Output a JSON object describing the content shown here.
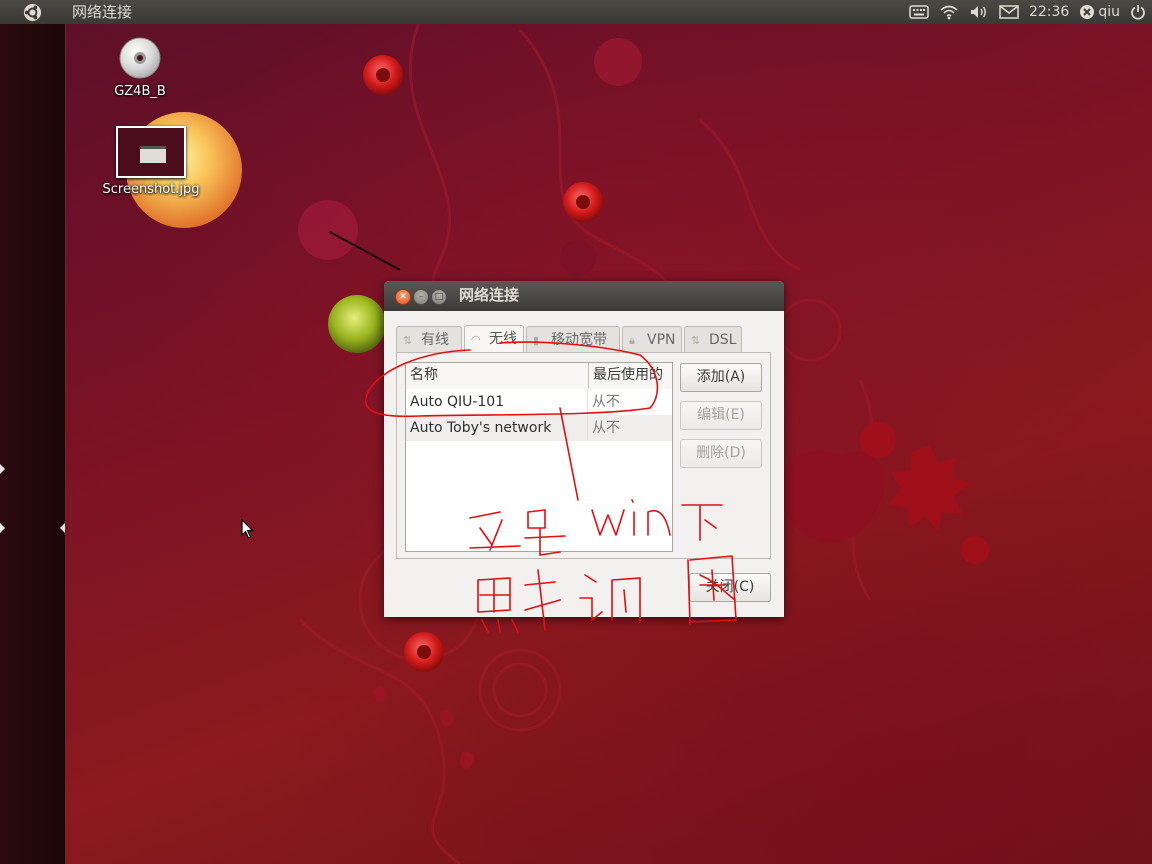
{
  "top_panel": {
    "title": "网络连接",
    "clock": "22:36",
    "user": "qiu",
    "icons": [
      "ubuntu-logo-icon",
      "keyboard-icon",
      "wifi-icon",
      "volume-icon",
      "mail-icon",
      "user-status-icon",
      "power-icon"
    ]
  },
  "desktop": {
    "icons": [
      {
        "label": "GZ4B_B",
        "icon": "dvd-icon"
      },
      {
        "label": "Screenshot.jpg",
        "icon": "image-thumbnail"
      }
    ]
  },
  "window": {
    "title": "网络连接",
    "tabs": [
      {
        "label": "有线",
        "icon": "wired-icon",
        "active": false
      },
      {
        "label": "无线",
        "icon": "wireless-icon",
        "active": true
      },
      {
        "label": "移动宽带",
        "icon": "mobile-broadband-icon",
        "active": false
      },
      {
        "label": "VPN",
        "icon": "lock-icon",
        "active": false
      },
      {
        "label": "DSL",
        "icon": "dsl-icon",
        "active": false
      }
    ],
    "list": {
      "columns": [
        "名称",
        "最后使用的"
      ],
      "rows": [
        {
          "name": "Auto QIU-101",
          "last_used": "从不"
        },
        {
          "name": "Auto Toby's network",
          "last_used": "从不"
        }
      ]
    },
    "buttons": {
      "add": "添加(A)",
      "edit": "编辑(E)",
      "delete": "删除(D)",
      "close": "关闭(C)"
    }
  },
  "colors": {
    "annotation": "#e01010",
    "panel_bg": "#3c3b37",
    "close_button": "#e2541f"
  }
}
